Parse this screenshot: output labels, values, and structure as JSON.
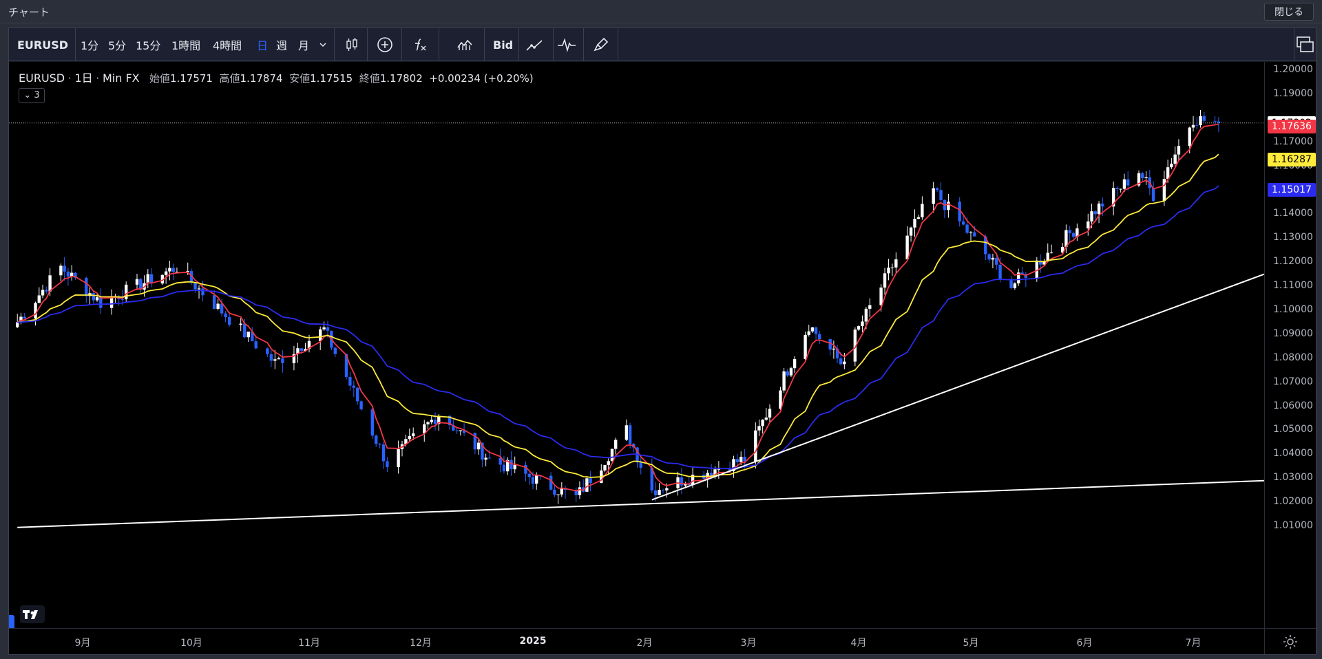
{
  "window": {
    "title": "チャート",
    "close_label": "閉じる"
  },
  "toolbar": {
    "symbol": "EURUSD",
    "intervals": [
      "1分",
      "5分",
      "15分",
      "1時間",
      "4時間",
      "日",
      "週",
      "月"
    ],
    "active_interval": "日",
    "bid_label": "Bid",
    "icons": [
      "candle-style-icon",
      "add-compare-icon",
      "indicators-icon",
      "templates-icon",
      "bid-ask-icon",
      "line-tool-icon",
      "pulse-icon",
      "brush-icon",
      "layout-icon"
    ]
  },
  "legend": {
    "symbol": "EURUSD",
    "interval": "1日",
    "source": "Min FX",
    "open_label": "始値",
    "open": "1.17571",
    "high_label": "高値",
    "high": "1.17874",
    "low_label": "安値",
    "low": "1.17515",
    "close_label": "終値",
    "close": "1.17802",
    "change": "+0.00234 (+0.20%)",
    "collapse_label": "3"
  },
  "price_axis": {
    "ticks": [
      "1.20000",
      "1.19000",
      "1.17000",
      "1.16000",
      "1.14000",
      "1.13000",
      "1.12000",
      "1.11000",
      "1.10000",
      "1.09000",
      "1.08000",
      "1.07000",
      "1.06000",
      "1.05000",
      "1.04000",
      "1.03000",
      "1.02000",
      "1.01000"
    ],
    "tags": [
      {
        "value": "1.17802",
        "bg": "#ffffff",
        "fg": "#000000"
      },
      {
        "value": "1.17636",
        "bg": "#f23645",
        "fg": "#ffffff"
      },
      {
        "value": "1.16287",
        "bg": "#ffeb3b",
        "fg": "#000000"
      },
      {
        "value": "1.15017",
        "bg": "#2b2bef",
        "fg": "#ffffff"
      }
    ]
  },
  "time_axis": {
    "labels": [
      "9月",
      "10月",
      "11月",
      "12月",
      "2025",
      "2月",
      "3月",
      "4月",
      "5月",
      "6月",
      "7月"
    ]
  },
  "chart_data": {
    "type": "candlestick",
    "colors": {
      "up": "#ffffff",
      "down": "#2962ff",
      "ma_fast": "#f23645",
      "ma_mid": "#ffeb3b",
      "ma_slow": "#2b2bef",
      "trendline": "#ffffff"
    },
    "ylim": [
      1.005,
      1.205
    ],
    "trendlines": [
      {
        "from": [
          "2024-08-14",
          1.0095
        ],
        "to": [
          "2025-07-08",
          1.029
        ]
      },
      {
        "from": [
          "2025-02-03",
          1.021
        ],
        "to": [
          "2025-07-08",
          1.115
        ]
      }
    ],
    "key_points": [
      {
        "date": "2024-08-14",
        "price": 1.095
      },
      {
        "date": "2024-08-26",
        "price": 1.118
      },
      {
        "date": "2024-09-06",
        "price": 1.103
      },
      {
        "date": "2024-09-27",
        "price": 1.118
      },
      {
        "date": "2024-10-23",
        "price": 1.078
      },
      {
        "date": "2024-11-05",
        "price": 1.092
      },
      {
        "date": "2024-11-22",
        "price": 1.036
      },
      {
        "date": "2024-12-06",
        "price": 1.057
      },
      {
        "date": "2024-12-20",
        "price": 1.038
      },
      {
        "date": "2025-01-13",
        "price": 1.022
      },
      {
        "date": "2025-01-27",
        "price": 1.05
      },
      {
        "date": "2025-02-03",
        "price": 1.025
      },
      {
        "date": "2025-02-28",
        "price": 1.038
      },
      {
        "date": "2025-03-18",
        "price": 1.094
      },
      {
        "date": "2025-03-27",
        "price": 1.078
      },
      {
        "date": "2025-04-21",
        "price": 1.15
      },
      {
        "date": "2025-05-12",
        "price": 1.11
      },
      {
        "date": "2025-06-05",
        "price": 1.143
      },
      {
        "date": "2025-06-16",
        "price": 1.158
      },
      {
        "date": "2025-06-20",
        "price": 1.148
      },
      {
        "date": "2025-07-01",
        "price": 1.18
      },
      {
        "date": "2025-07-08",
        "price": 1.178
      }
    ]
  }
}
